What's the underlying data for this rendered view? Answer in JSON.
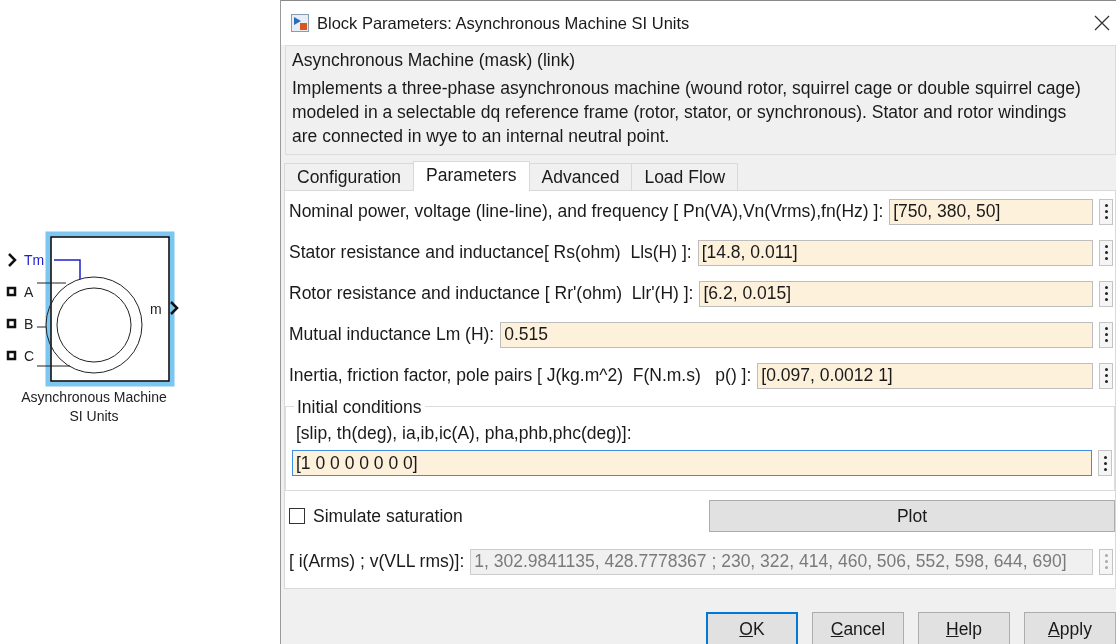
{
  "block": {
    "selected": true,
    "ports": [
      {
        "label": "Tm",
        "kind": "signal"
      },
      {
        "label": "A",
        "kind": "terminal"
      },
      {
        "label": "B",
        "kind": "terminal"
      },
      {
        "label": "C",
        "kind": "terminal"
      }
    ],
    "output_label": "m",
    "name_lines": [
      "Asynchronous Machine",
      "SI Units"
    ]
  },
  "window": {
    "title": "Block Parameters: Asynchronous Machine SI Units"
  },
  "mask": {
    "title": "Asynchronous Machine (mask) (link)",
    "description": "Implements a three-phase asynchronous machine (wound rotor, squirrel cage or double squirrel cage) modeled in a selectable dq reference frame (rotor, stator, or synchronous). Stator and rotor windings are connected in wye to an internal neutral point."
  },
  "tabs": [
    {
      "label": "Configuration",
      "selected": false
    },
    {
      "label": "Parameters",
      "selected": true
    },
    {
      "label": "Advanced",
      "selected": false
    },
    {
      "label": "Load Flow",
      "selected": false
    }
  ],
  "parameters": [
    {
      "label": "Nominal power, voltage (line-line), and frequency [ Pn(VA),Vn(Vrms),fn(Hz) ]:",
      "value": "[750, 380, 50]"
    },
    {
      "label": "Stator resistance and inductance[ Rs(ohm)  Lls(H) ]:",
      "value": "[14.8, 0.011]"
    },
    {
      "label": "Rotor resistance and inductance [ Rr'(ohm)  Llr'(H) ]:",
      "value": "[6.2, 0.015]"
    },
    {
      "label": "Mutual inductance Lm (H):",
      "value": "0.515"
    },
    {
      "label": "Inertia, friction factor, pole pairs [ J(kg.m^2)  F(N.m.s)   p() ]:",
      "value": "[0.097, 0.0012 1]"
    }
  ],
  "initial_conditions": {
    "title": "Initial conditions",
    "label": "[slip, th(deg), ia,ib,ic(A), pha,phb,phc(deg)]:",
    "value": "[1 0 0 0 0 0 0 0]",
    "focused": true
  },
  "saturation": {
    "label": "Simulate saturation",
    "checked": false
  },
  "plot_button": "Plot",
  "saturation_data": {
    "label": "[ i(Arms) ; v(VLL rms)]:",
    "value": "1, 302.9841135, 428.7778367 ; 230, 322, 414, 460, 506, 552, 598, 644, 690]",
    "disabled": true
  },
  "buttons": [
    {
      "label": "OK",
      "mnemonic_underlined": true,
      "default": true
    },
    {
      "label": "Cancel",
      "mnemonic_underlined": true,
      "default": false
    },
    {
      "label": "Help",
      "mnemonic_underlined": true,
      "default": false
    },
    {
      "label": "Apply",
      "mnemonic_underlined": true,
      "default": false
    }
  ]
}
